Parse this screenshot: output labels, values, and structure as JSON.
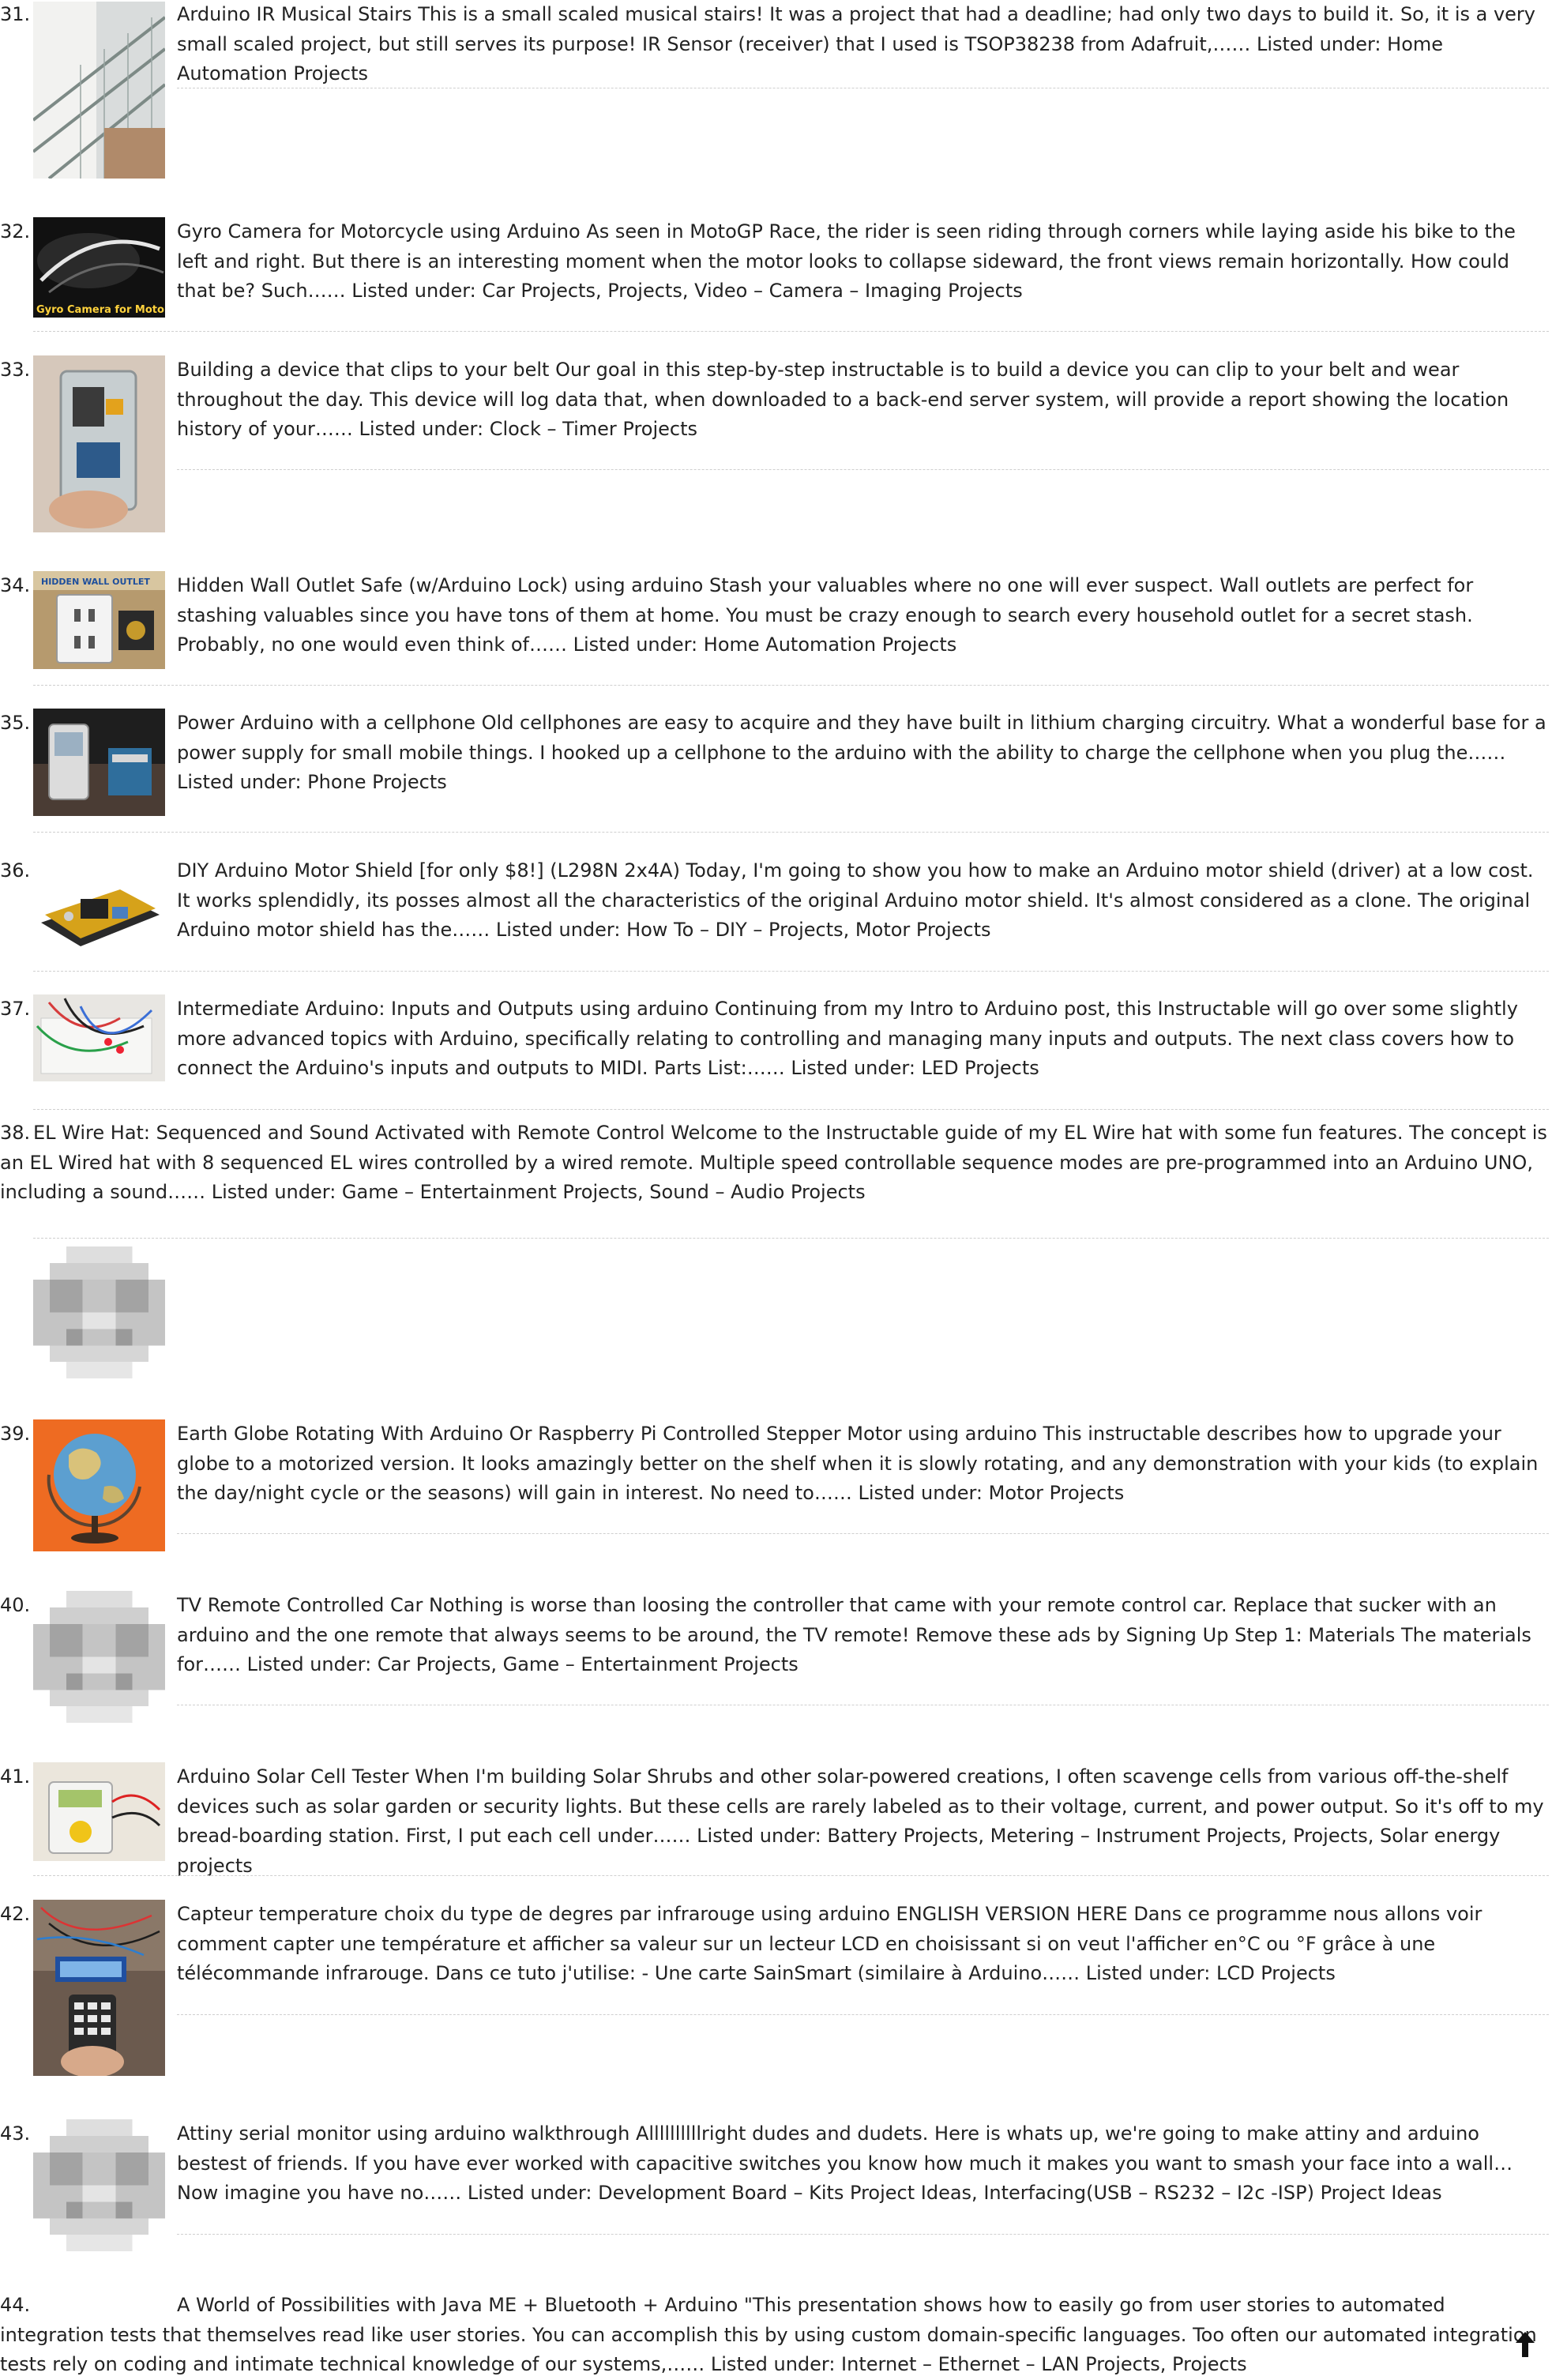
{
  "items": [
    {
      "number": "31.",
      "text": "Arduino IR Musical Stairs This is a small scaled musical stairs! It was a project that had a deadline; had only two days to build it. So, it is a very small scaled project, but still serves its purpose! IR Sensor (receiver) that I used is TSOP38238 from Adafruit,…… Listed under: Home Automation Projects",
      "thumb": "stairs-photo"
    },
    {
      "number": "32.",
      "text": "Gyro Camera for Motorcycle using Arduino As seen in MotoGP Race, the rider is seen riding through corners while laying aside his bike to the left and right. But there is an interesting moment when the motor looks to collapse sideward, the front views remain horizontally. How could that be? Such…… Listed under: Car Projects, Projects, Video – Camera – Imaging Projects",
      "thumb": "motorcycle-photo",
      "thumb_caption": "Gyro Camera for Motorcycle"
    },
    {
      "number": "33.",
      "text": "Building a device that clips to your belt Our goal in this step-by-step instructable is to build a device you can clip to your belt and wear throughout the day.  This device will log data that, when downloaded to a back-end server system, will provide a report showing the location history of your…… Listed under: Clock – Timer Projects",
      "thumb": "belt-device-photo"
    },
    {
      "number": "34.",
      "text": "Hidden Wall Outlet Safe (w/Arduino Lock) using arduino Stash your valuables where no one will ever suspect. Wall outlets are perfect for stashing valuables since you have tons of them at home. You must be crazy enough to search every household outlet for a secret stash. Probably, no one would even think of…… Listed under: Home Automation Projects",
      "thumb": "wall-outlet-photo",
      "thumb_caption": "HIDDEN WALL OUTLET"
    },
    {
      "number": "35.",
      "text": "Power Arduino with a cellphone Old cellphones are easy to acquire and they have built in lithium charging circuitry. What a wonderful base for a power supply for small mobile things. I hooked up a cellphone to the arduino with the ability to charge the cellphone when you plug the…… Listed under: Phone Projects",
      "thumb": "cellphone-photo"
    },
    {
      "number": "36.",
      "text": "DIY Arduino Motor Shield [for only $8!] (L298N 2x4A) Today, I'm going to show you how to make an Arduino motor shield (driver) at a low cost. It works splendidly, its posses almost all the characteristics of the original Arduino motor shield. It's almost considered as a clone. The original Arduino motor shield has the…… Listed under: How To – DIY – Projects, Motor Projects",
      "thumb": "motor-shield-photo"
    },
    {
      "number": "37.",
      "text": "Intermediate Arduino: Inputs and Outputs using arduino Continuing from my Intro to Arduino post, this Instructable will go over some slightly more advanced topics with Arduino, specifically relating to controlling and managing many inputs and outputs. The next class covers how to connect the Arduino's inputs and outputs to MIDI. Parts List:…… Listed under: LED Projects",
      "thumb": "breadboard-photo"
    },
    {
      "number": "38.",
      "text": "EL Wire Hat: Sequenced and Sound Activated with Remote Control Welcome to the Instructable guide of my EL Wire hat with some fun features. The concept is an EL Wired hat with 8 sequenced EL wires controlled by a wired remote. Multiple speed controllable sequence modes are pre-programmed into an Arduino UNO, including a sound…… Listed under: Game – Entertainment Projects, Sound – Audio Projects",
      "thumb": "placeholder-image"
    },
    {
      "number": "39.",
      "text": "Earth Globe Rotating With Arduino Or Raspberry Pi Controlled Stepper Motor using arduino This instructable describes how to upgrade your globe to a motorized version. It looks amazingly better on the shelf when it is slowly rotating, and any demonstration with your kids (to explain the day/night cycle or the seasons) will gain in interest. No need to…… Listed under: Motor Projects",
      "thumb": "globe-photo"
    },
    {
      "number": "40.",
      "text": "TV Remote Controlled Car Nothing is worse than loosing the controller that came with your remote control car. Replace that sucker with an arduino and the one remote that always seems to be around, the TV remote! Remove these ads by Signing Up Step 1: Materials The materials for…… Listed under: Car Projects, Game – Entertainment Projects",
      "thumb": "placeholder-image"
    },
    {
      "number": "41.",
      "text": "Arduino Solar Cell Tester When I'm building Solar Shrubs and other solar-powered creations, I often scavenge cells from various off-the-shelf devices such as solar garden or security lights. But these cells are rarely labeled as to their voltage, current, and power output. So it's off to my bread-boarding station. First, I put each cell under…… Listed under: Battery Projects, Metering – Instrument Projects, Projects, Solar energy projects",
      "thumb": "solar-tester-photo"
    },
    {
      "number": "42.",
      "text": "Capteur temperature choix du type de degres par infrarouge using arduino ENGLISH VERSION HERE Dans ce programme nous allons voir comment capter une température et afficher sa valeur sur un lecteur LCD en choisissant si on veut l'afficher en°C ou °F grâce à une télécommande infrarouge. Dans ce tuto j'utilise: - Une carte SainSmart (similaire à Arduino…… Listed under: LCD Projects",
      "thumb": "lcd-remote-photo"
    },
    {
      "number": "43.",
      "text": "Attiny serial monitor using arduino walkthrough Allllllllllright dudes and dudets. Here is whats up, we're going to make attiny and arduino bestest of friends. If you have ever worked with capacitive switches you know how much it makes you want to smash your face into a wall…Now imagine you have no…… Listed under: Development Board – Kits Project Ideas, Interfacing(USB – RS232 – I2c -ISP) Project Ideas",
      "thumb": "placeholder-image"
    },
    {
      "number": "44.",
      "text": "A World of Possibilities with Java ME + Bluetooth + Arduino \"This presentation shows how to easily go from user stories to automated integration tests that themselves read like user stories. You can accomplish this by using custom domain-specific languages. Too often our automated integration tests rely on coding and intimate technical knowledge of our systems,…… Listed under: Internet – Ethernet – LAN Projects, Projects"
    }
  ],
  "back_to_top_icon": "arrow-up-icon"
}
